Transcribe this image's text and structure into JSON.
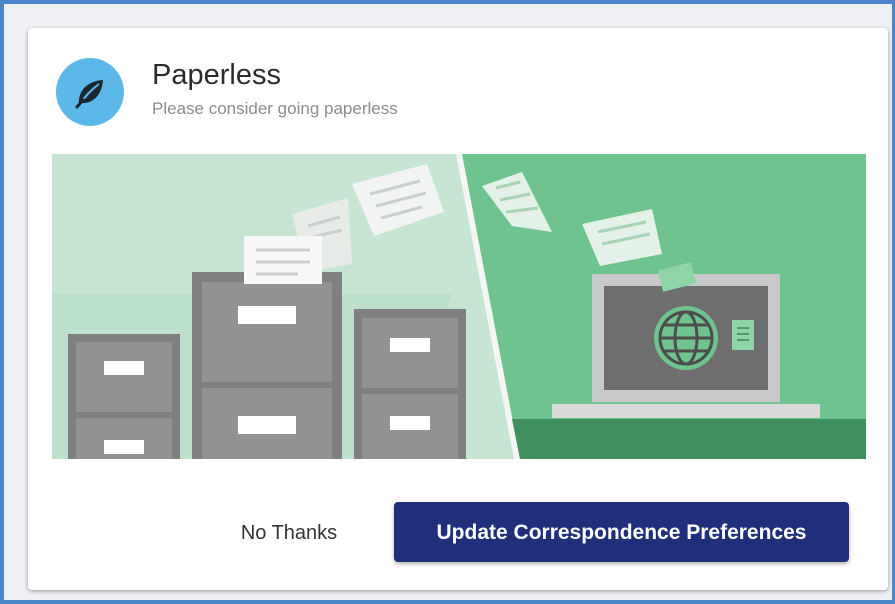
{
  "dialog": {
    "title": "Paperless",
    "subtitle": "Please consider going paperless",
    "icon": "leaf-icon",
    "illustration": "filing-cabinets-to-laptop-illustration"
  },
  "actions": {
    "dismiss_label": "No Thanks",
    "confirm_label": "Update Correspondence Preferences"
  },
  "colors": {
    "frame": "#4a86c8",
    "avatar": "#5bb8e8",
    "primary_button": "#1f2f7a",
    "left_panel": "#c6e6d3",
    "right_panel": "#6ec38e"
  }
}
